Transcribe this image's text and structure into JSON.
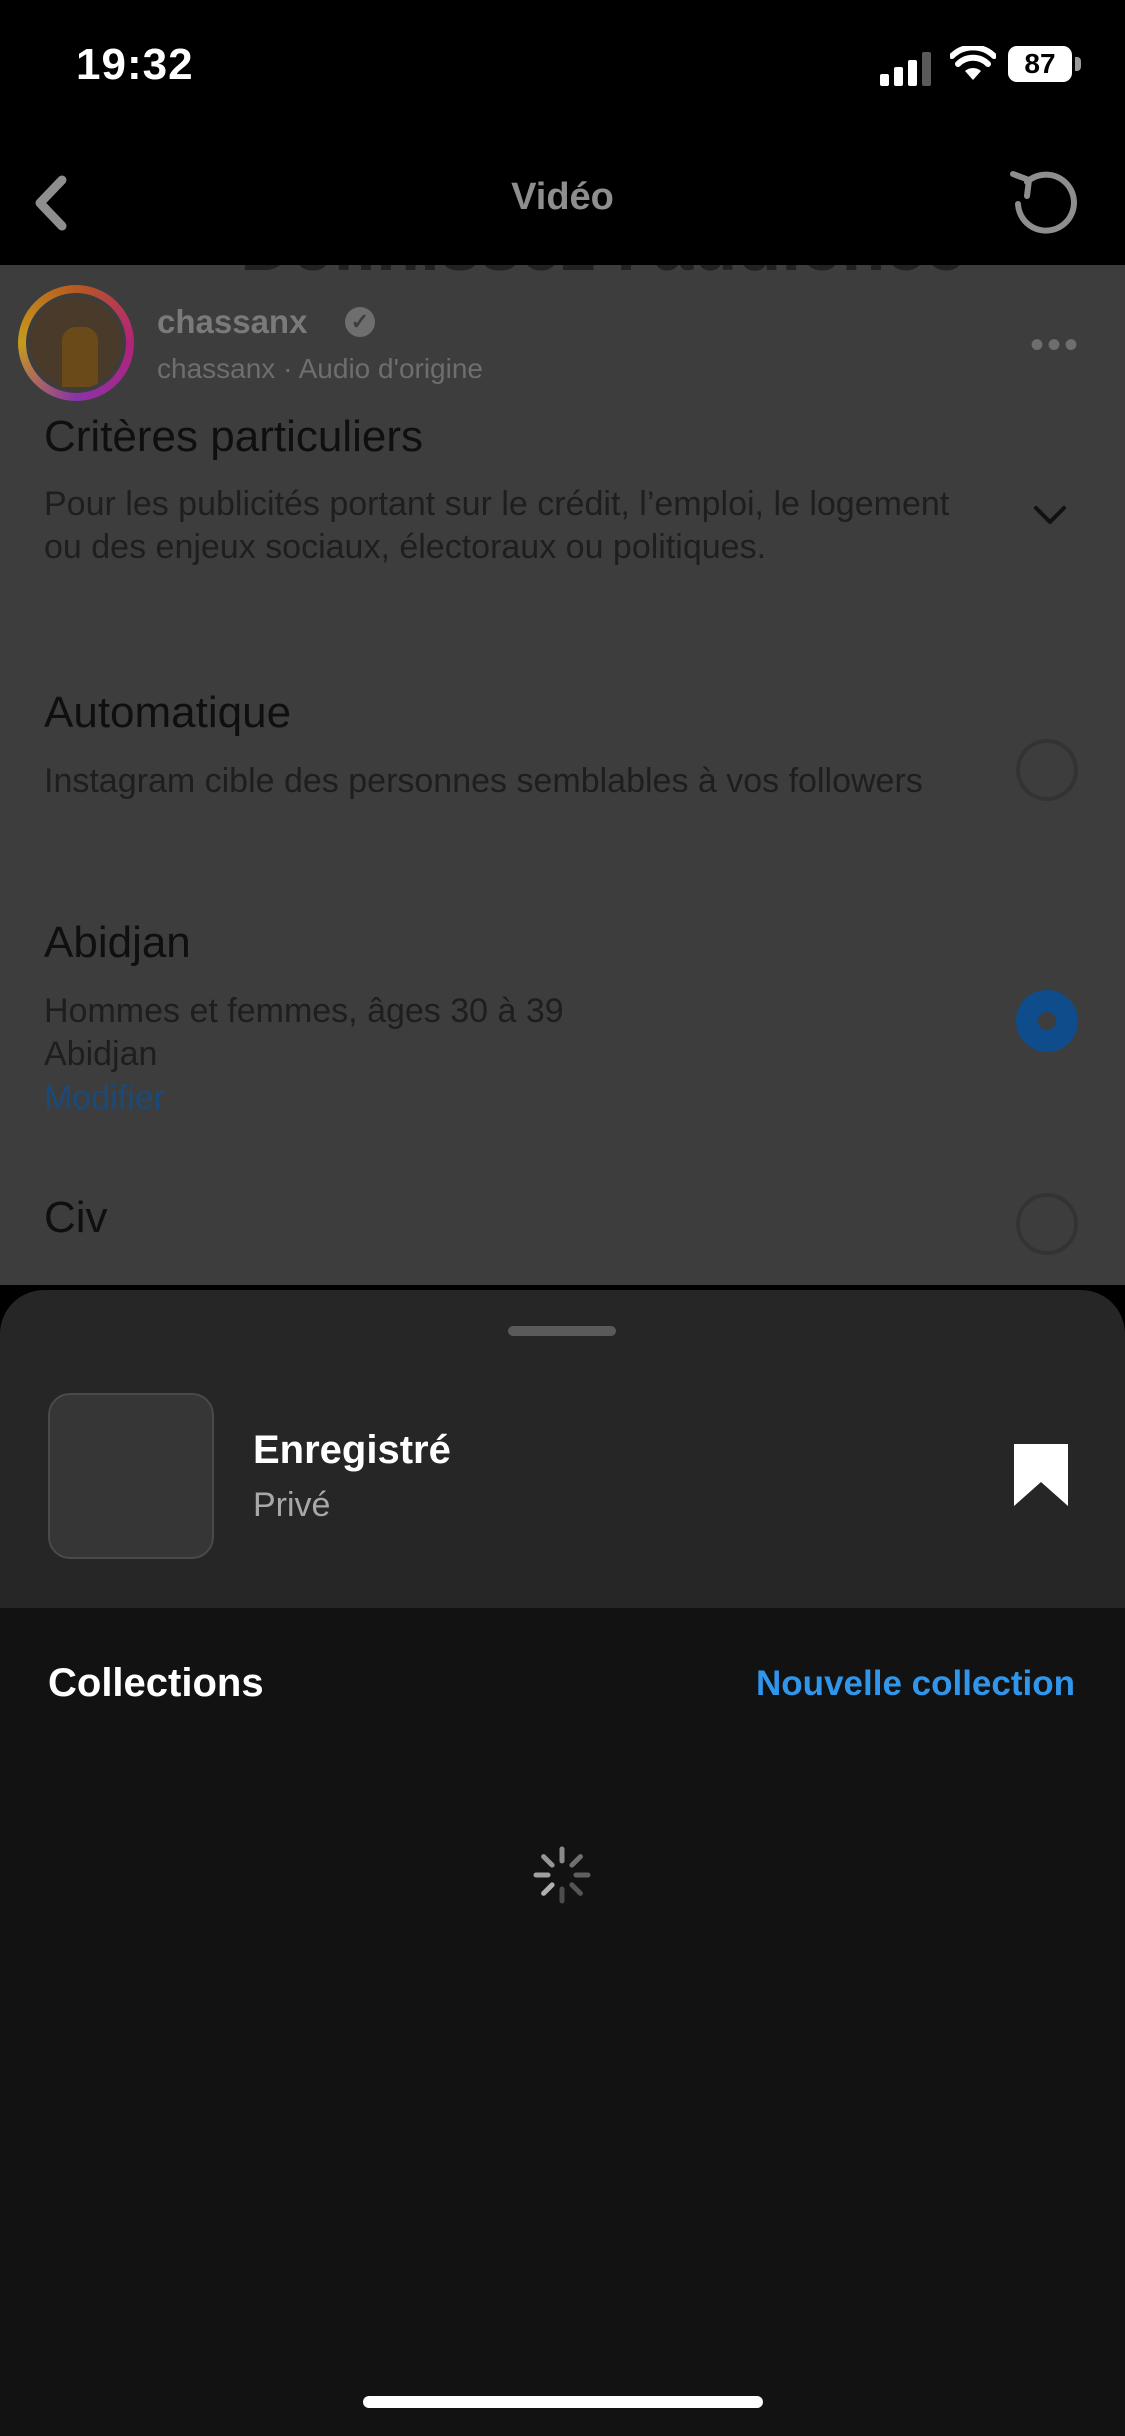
{
  "status_bar": {
    "time": "19:32",
    "battery": "87"
  },
  "nav": {
    "title": "Vidéo",
    "back_icon": "chevron-left-icon",
    "refresh_icon": "refresh-icon"
  },
  "background": {
    "partial_heading": "Définissez l'audience",
    "post": {
      "username": "chassanx",
      "subtitle": "chassanx · Audio d'origine"
    },
    "options": [
      {
        "title": "Critères particuliers",
        "desc": "Pour les publicités portant sur le crédit, l’emploi, le logement ou des enjeux sociaux, électoraux ou politiques."
      },
      {
        "title": "Automatique",
        "desc": "Instagram cible des personnes semblables à vos followers",
        "selected": false
      },
      {
        "title": "Abidjan",
        "desc_line1": "Hommes et femmes, âges 30 à 39",
        "desc_line2": "Abidjan",
        "link": "Modifier",
        "selected": true
      },
      {
        "title": "Civ",
        "selected": false
      }
    ]
  },
  "sheet": {
    "saved_title": "Enregistré",
    "saved_subtitle": "Privé",
    "collections_label": "Collections",
    "new_collection_label": "Nouvelle collection"
  },
  "colors": {
    "accent": "#2f96ec",
    "sheet_bg": "#262626",
    "lower_bg": "#121212",
    "overlay_bg": "#3d3d3d"
  }
}
